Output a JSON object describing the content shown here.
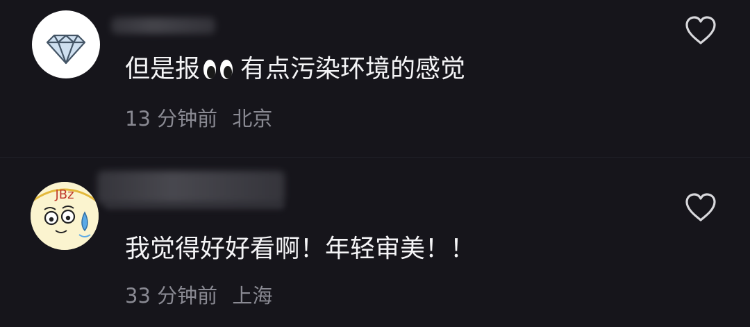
{
  "comments": [
    {
      "text_before": "但是报",
      "text_after": "有点污染环境的感觉",
      "time": "13 分钟前",
      "location": "北京",
      "avatar_icon": "diamond-icon",
      "inline_emoji": "eyes-emoji"
    },
    {
      "text": "我觉得好好看啊！年轻审美！！",
      "time": "33 分钟前",
      "location": "上海",
      "avatar_icon": "cartoon-face-avatar",
      "avatar_text": "JBz"
    }
  ],
  "colors": {
    "background": "#16151b",
    "text": "#f4f4f6",
    "meta": "#8a8a93",
    "heart_outline": "#d8d8dc"
  }
}
